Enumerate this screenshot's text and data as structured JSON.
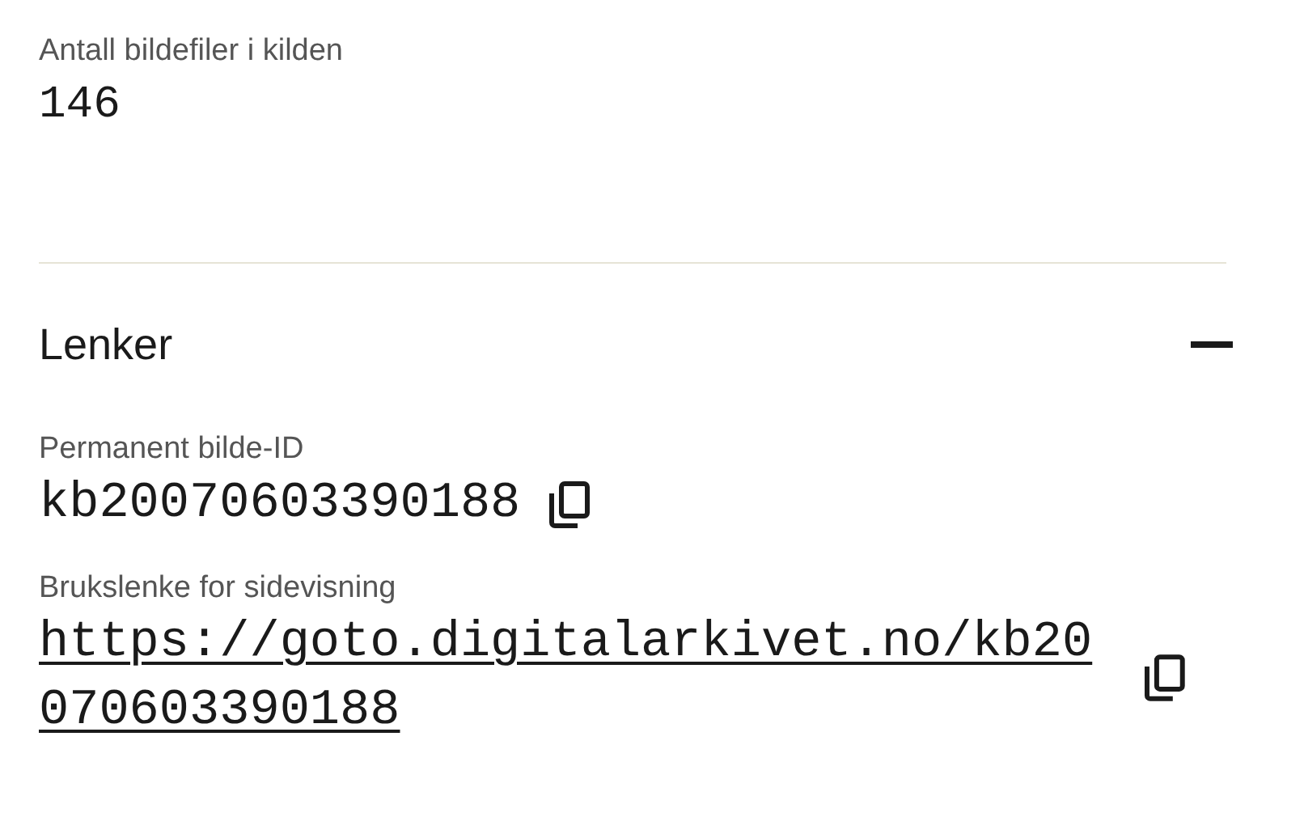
{
  "source_info": {
    "label": "Antall bildefiler i kilden",
    "value": "146"
  },
  "links_section": {
    "title": "Lenker",
    "expanded": true,
    "fields": [
      {
        "label": "Permanent bilde-ID",
        "value": "kb20070603390188",
        "kind": "text"
      },
      {
        "label": "Brukslenke for sidevisning",
        "value": "https://goto.digitalarkivet.no/kb20070603390188",
        "kind": "link"
      }
    ]
  }
}
